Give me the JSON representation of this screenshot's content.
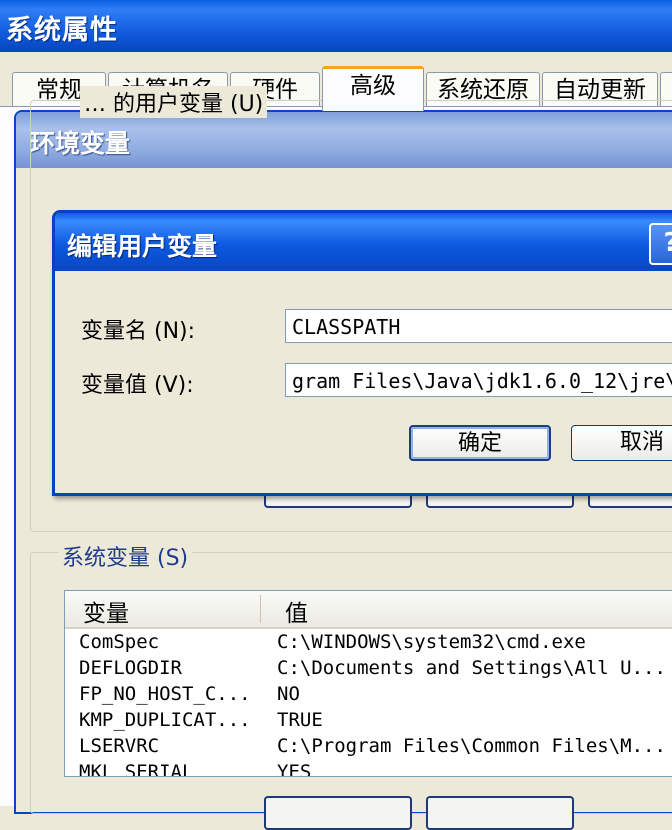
{
  "system_properties": {
    "title": "系统属性"
  },
  "tabs": [
    {
      "label": "常规"
    },
    {
      "label": "计算机名"
    },
    {
      "label": "硬件"
    },
    {
      "label": "高级"
    },
    {
      "label": "系统还原"
    },
    {
      "label": "自动更新"
    }
  ],
  "active_tab": "高级",
  "env_window": {
    "title": "环境变量",
    "user_group_label": "… 的用户变量 (U)",
    "system_group_label": "系统变量 (S)",
    "columns": {
      "name": "变量",
      "value": "值"
    },
    "system_vars": [
      {
        "name": "ComSpec",
        "value": "C:\\WINDOWS\\system32\\cmd.exe"
      },
      {
        "name": "DEFLOGDIR",
        "value": "C:\\Documents and Settings\\All U..."
      },
      {
        "name": "FP_NO_HOST_C...",
        "value": "NO"
      },
      {
        "name": "KMP_DUPLICAT...",
        "value": "TRUE"
      },
      {
        "name": "LSERVRC",
        "value": "C:\\Program Files\\Common Files\\M..."
      },
      {
        "name": "MKL_SERIAL",
        "value": "YES"
      }
    ]
  },
  "edit_dialog": {
    "title": "编辑用户变量",
    "help_label": "?",
    "name_label": "变量名 (N):",
    "value_label": "变量值 (V):",
    "name_value": "CLASSPATH",
    "value_value": "gram Files\\Java\\jdk1.6.0_12\\jre\\",
    "ok_label": "确定",
    "cancel_label": "取消"
  },
  "colors": {
    "title_blue": "#0a5fe0",
    "dialog_face": "#ece9d8",
    "tab_active_accent": "#f7a51d"
  }
}
